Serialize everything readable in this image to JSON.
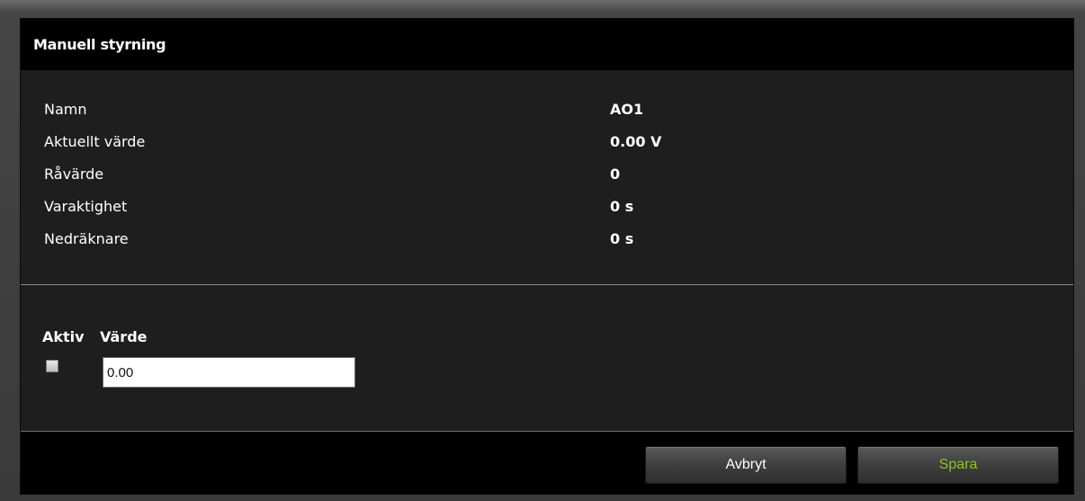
{
  "dialog": {
    "title": "Manuell styrning"
  },
  "info": {
    "rows": [
      {
        "label": "Namn",
        "value": "AO1"
      },
      {
        "label": "Aktuellt värde",
        "value": "0.00 V"
      },
      {
        "label": "Råvärde",
        "value": "0"
      },
      {
        "label": "Varaktighet",
        "value": "0 s"
      },
      {
        "label": "Nedräknare",
        "value": "0 s"
      }
    ]
  },
  "control": {
    "active_label": "Aktiv",
    "value_label": "Värde",
    "active_checked": false,
    "value": "0.00"
  },
  "footer": {
    "cancel_label": "Avbryt",
    "save_label": "Spara"
  },
  "colors": {
    "save_text": "#8fc31f",
    "background": "#1e1e1e",
    "titlebar": "#000000"
  }
}
